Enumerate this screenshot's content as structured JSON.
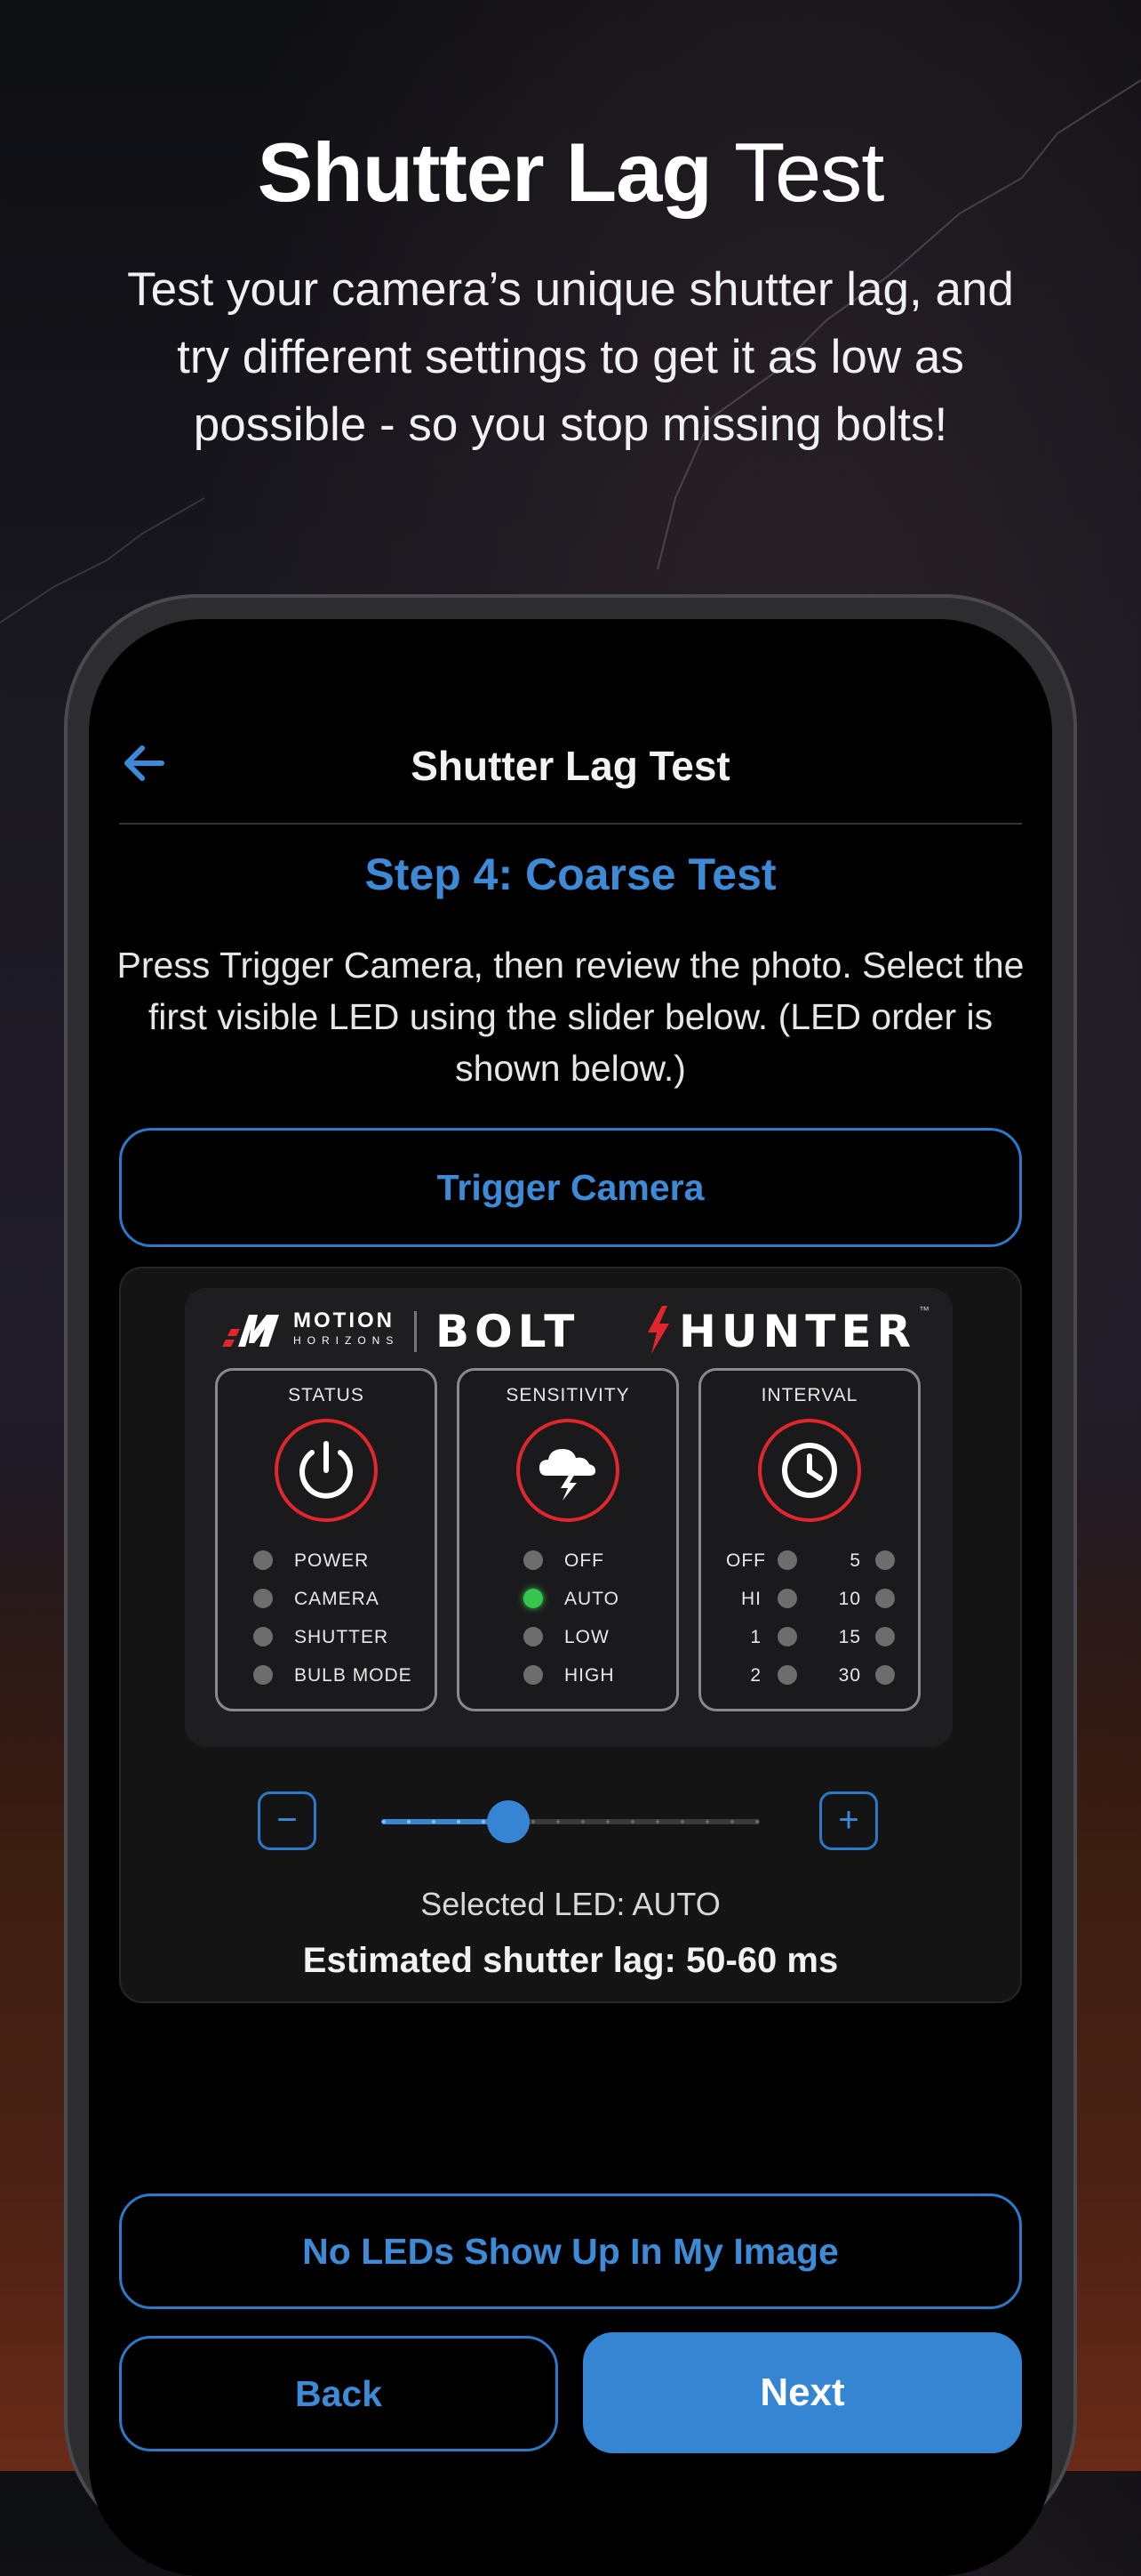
{
  "marketing": {
    "headline_bold": "Shutter Lag",
    "headline_light": "Test",
    "subtitle": "Test your camera’s unique shutter lag, and try different settings to get it as low as possible - so you stop missing bolts!"
  },
  "navbar": {
    "title": "Shutter Lag Test",
    "back_icon": "arrow-left-icon"
  },
  "step": {
    "title": "Step 4: Coarse Test",
    "instructions": "Press Trigger Camera, then review the photo. Select the first visible LED using the slider below. (LED order is shown below.)"
  },
  "buttons": {
    "trigger": "Trigger Camera",
    "no_leds": "No LEDs Show Up In My Image",
    "back": "Back",
    "next": "Next"
  },
  "device": {
    "brand_top": "MOTION",
    "brand_bottom": "HORIZONS",
    "product_left": "BOLT",
    "product_right": "HUNTER",
    "trademark": "™",
    "groups": [
      {
        "title": "STATUS",
        "icon": "power-icon",
        "leds": [
          {
            "label": "POWER",
            "on": false
          },
          {
            "label": "CAMERA",
            "on": false
          },
          {
            "label": "SHUTTER",
            "on": false
          },
          {
            "label": "BULB MODE",
            "on": false
          }
        ]
      },
      {
        "title": "SENSITIVITY",
        "icon": "storm-cloud-icon",
        "leds": [
          {
            "label": "OFF",
            "on": false
          },
          {
            "label": "AUTO",
            "on": true
          },
          {
            "label": "LOW",
            "on": false
          },
          {
            "label": "HIGH",
            "on": false
          }
        ]
      },
      {
        "title": "INTERVAL",
        "icon": "clock-icon",
        "leds_left": [
          "OFF",
          "HI",
          "1",
          "2"
        ],
        "leds_right": [
          "5",
          "10",
          "15",
          "30"
        ]
      }
    ]
  },
  "slider": {
    "minus": "−",
    "plus": "+",
    "position_index": 5,
    "total_steps": 16,
    "selected_text": "Selected LED: AUTO",
    "estimate_text": "Estimated shutter lag: 50-60 ms"
  },
  "colors": {
    "accent": "#3585d3",
    "led_on": "#36c64e",
    "icon_ring": "#e1262d"
  }
}
